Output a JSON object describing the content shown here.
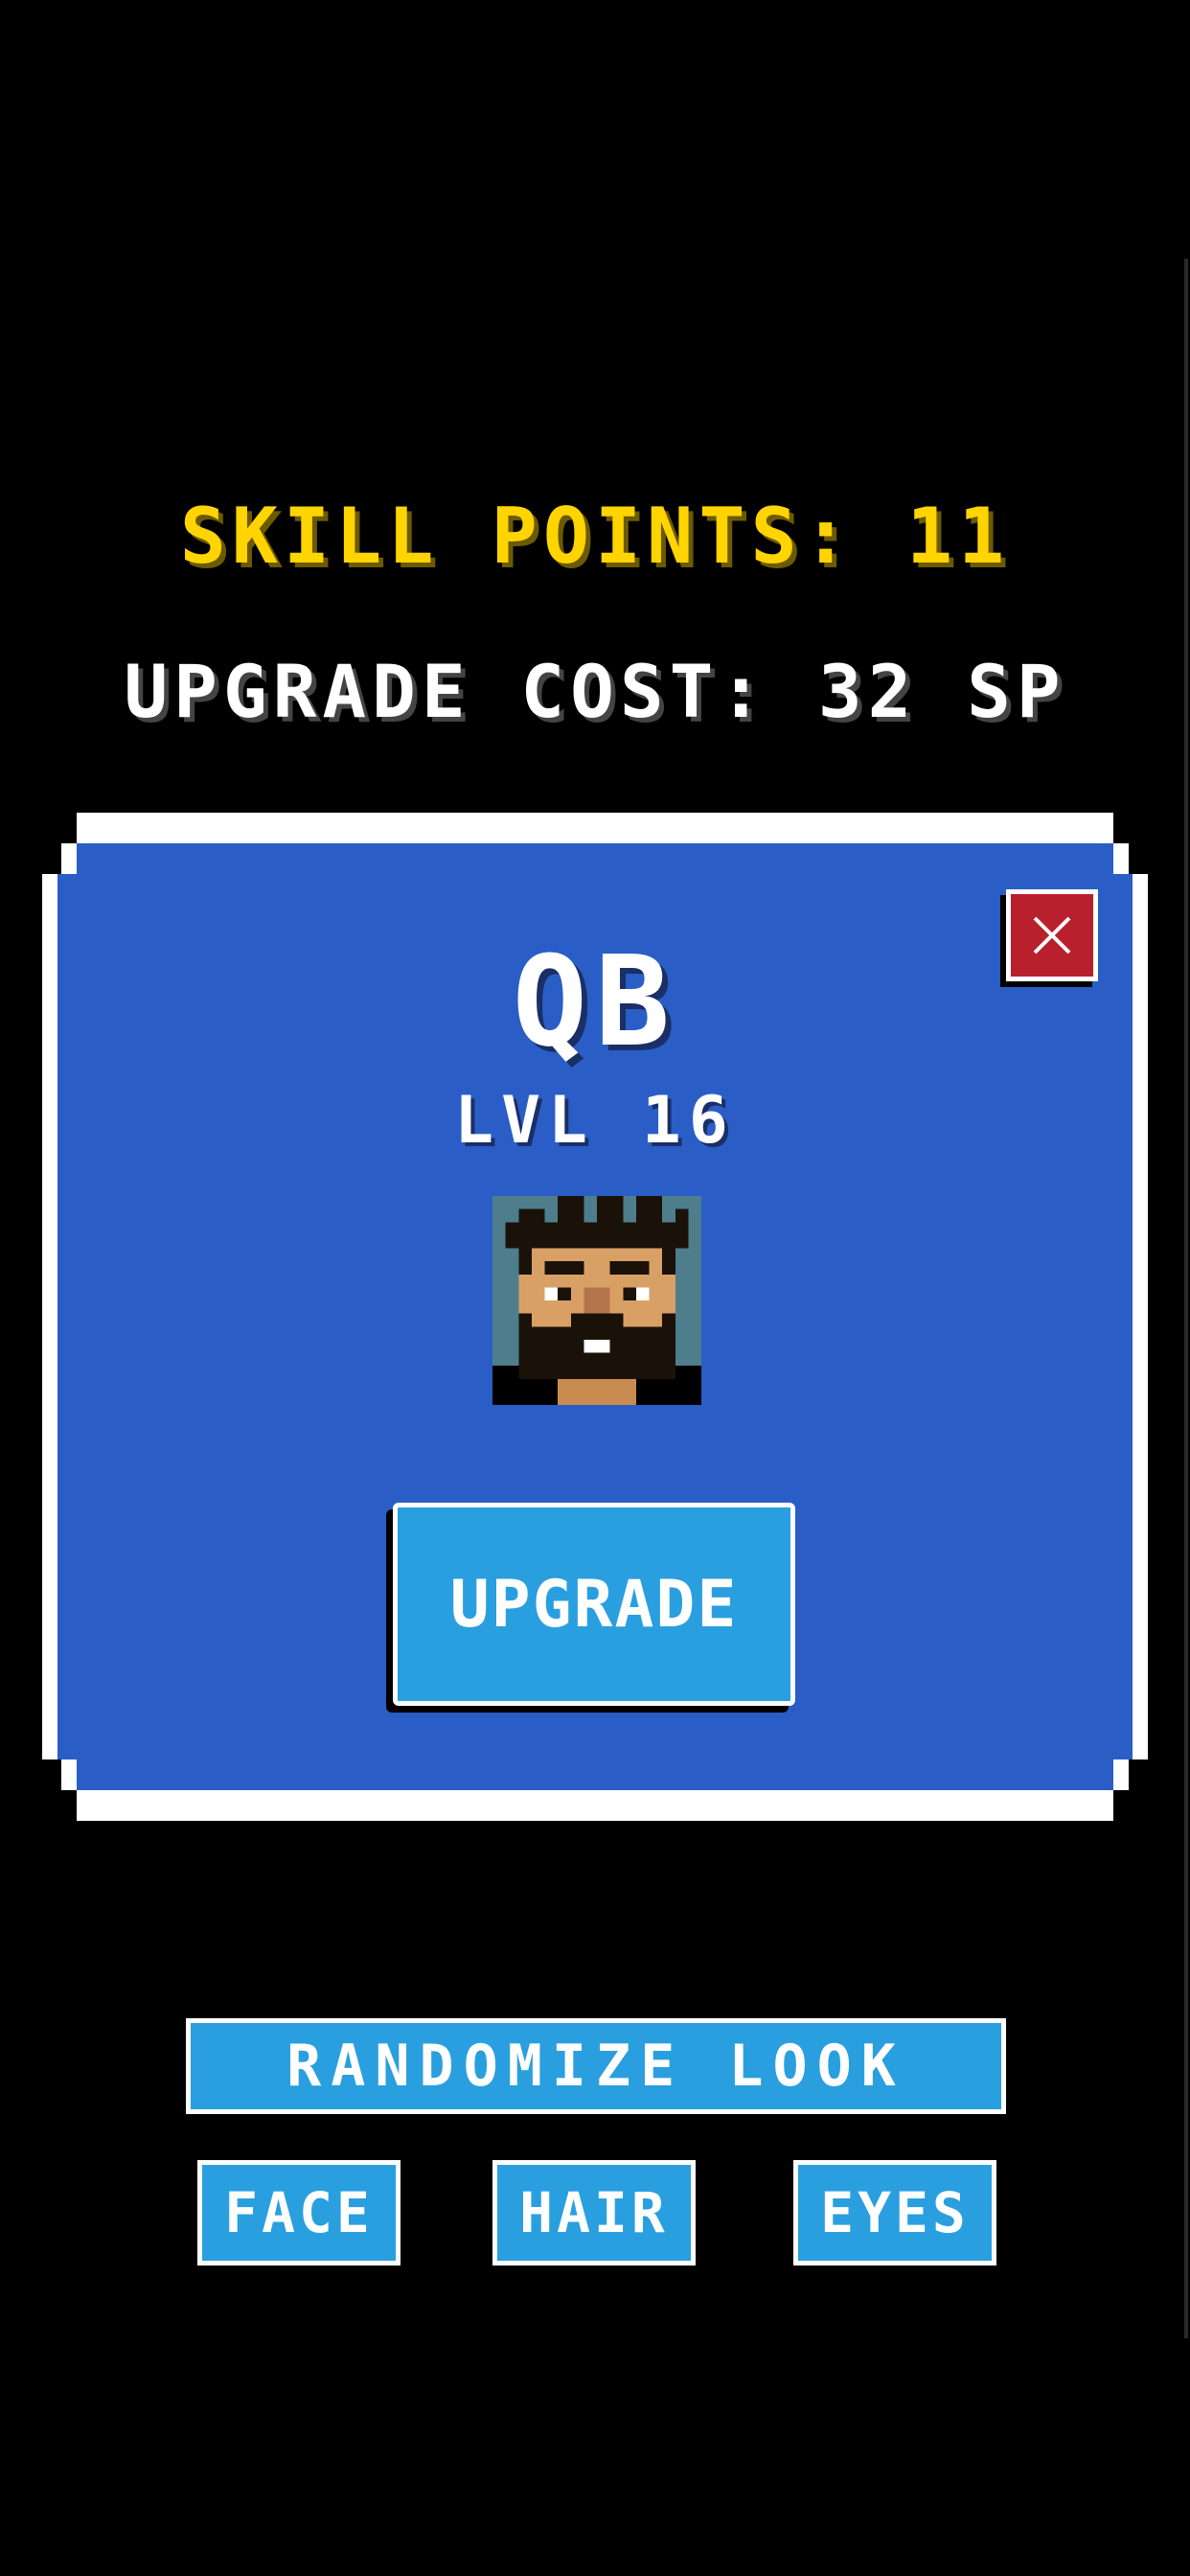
{
  "header": {
    "skill_points": "SKILL POINTS: 11",
    "upgrade_cost": "UPGRADE COST: 32 SP"
  },
  "card": {
    "close_icon": "close-icon",
    "position": "QB",
    "level": "LVL 16",
    "upgrade_label": "UPGRADE"
  },
  "customize": {
    "randomize_label": "RANDOMIZE LOOK",
    "face_label": "FACE",
    "hair_label": "HAIR",
    "eyes_label": "EYES"
  },
  "colors": {
    "background": "#000000",
    "skill_points_text": "#FFD400",
    "card_blue": "#2A5EC6",
    "button_blue": "#2A9FDF",
    "close_red": "#B8202E",
    "avatar_bg": "#4E7E8C",
    "skin": "#D9A066",
    "hair_beard": "#1A1209"
  }
}
